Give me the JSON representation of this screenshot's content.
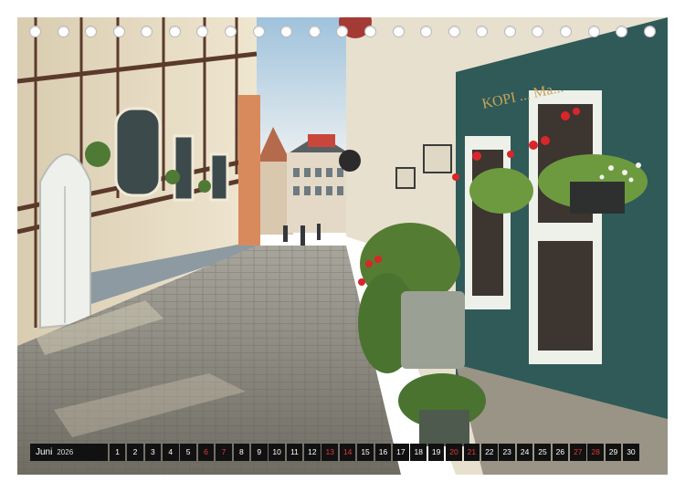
{
  "calendar": {
    "month": "Juni",
    "year": "2026",
    "days": [
      {
        "n": "1",
        "weekend": false
      },
      {
        "n": "2",
        "weekend": false
      },
      {
        "n": "3",
        "weekend": false
      },
      {
        "n": "4",
        "weekend": false
      },
      {
        "n": "5",
        "weekend": false
      },
      {
        "n": "6",
        "weekend": true
      },
      {
        "n": "7",
        "weekend": true
      },
      {
        "n": "8",
        "weekend": false
      },
      {
        "n": "9",
        "weekend": false
      },
      {
        "n": "10",
        "weekend": false
      },
      {
        "n": "11",
        "weekend": false
      },
      {
        "n": "12",
        "weekend": false
      },
      {
        "n": "13",
        "weekend": true
      },
      {
        "n": "14",
        "weekend": true
      },
      {
        "n": "15",
        "weekend": false
      },
      {
        "n": "16",
        "weekend": false
      },
      {
        "n": "17",
        "weekend": false
      },
      {
        "n": "18",
        "weekend": false
      },
      {
        "n": "19",
        "weekend": false
      },
      {
        "n": "20",
        "weekend": true
      },
      {
        "n": "21",
        "weekend": true
      },
      {
        "n": "22",
        "weekend": false
      },
      {
        "n": "23",
        "weekend": false
      },
      {
        "n": "24",
        "weekend": false
      },
      {
        "n": "25",
        "weekend": false
      },
      {
        "n": "26",
        "weekend": false
      },
      {
        "n": "27",
        "weekend": true
      },
      {
        "n": "28",
        "weekend": true
      },
      {
        "n": "29",
        "weekend": false
      },
      {
        "n": "30",
        "weekend": false
      }
    ]
  },
  "photo": {
    "sign_text": "KOPI ... Ma..."
  },
  "colors": {
    "weekend": "#e03b3b",
    "bar": "#111111",
    "facade_green": "#2f5a58",
    "sky": "#bcd6e8"
  }
}
